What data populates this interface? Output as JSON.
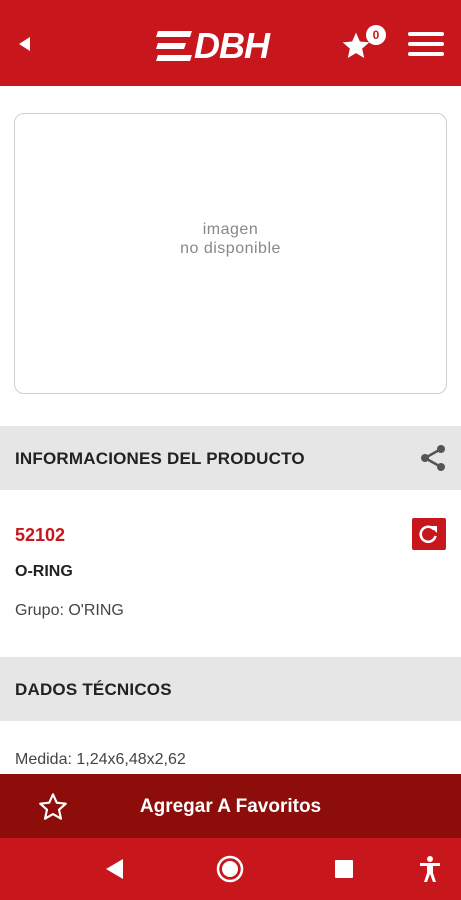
{
  "header": {
    "brand": "DBH",
    "favorites_count": "0",
    "icons": {
      "back": "back-arrow-icon",
      "favorites": "star-icon",
      "menu": "hamburger-menu-icon"
    }
  },
  "image": {
    "placeholder_line1": "imagen",
    "placeholder_line2": "no disponible"
  },
  "info_section": {
    "title": "INFORMACIONES DEL PRODUCTO",
    "code": "52102",
    "name": "O-RING",
    "group": "Grupo: O'RING"
  },
  "tech_section": {
    "title": "DADOS TÉCNICOS",
    "medida": "Medida: 1,24x6,48x2,62"
  },
  "favorite_bar": {
    "label": "Agregar A Favoritos"
  },
  "system_nav": {
    "icons": [
      "back-triangle-icon",
      "home-circle-icon",
      "recents-square-icon",
      "accessibility-icon"
    ]
  },
  "colors": {
    "primary": "#c8161d",
    "dark_primary": "#8c0d0a",
    "section_bg": "#e6e6e6"
  }
}
